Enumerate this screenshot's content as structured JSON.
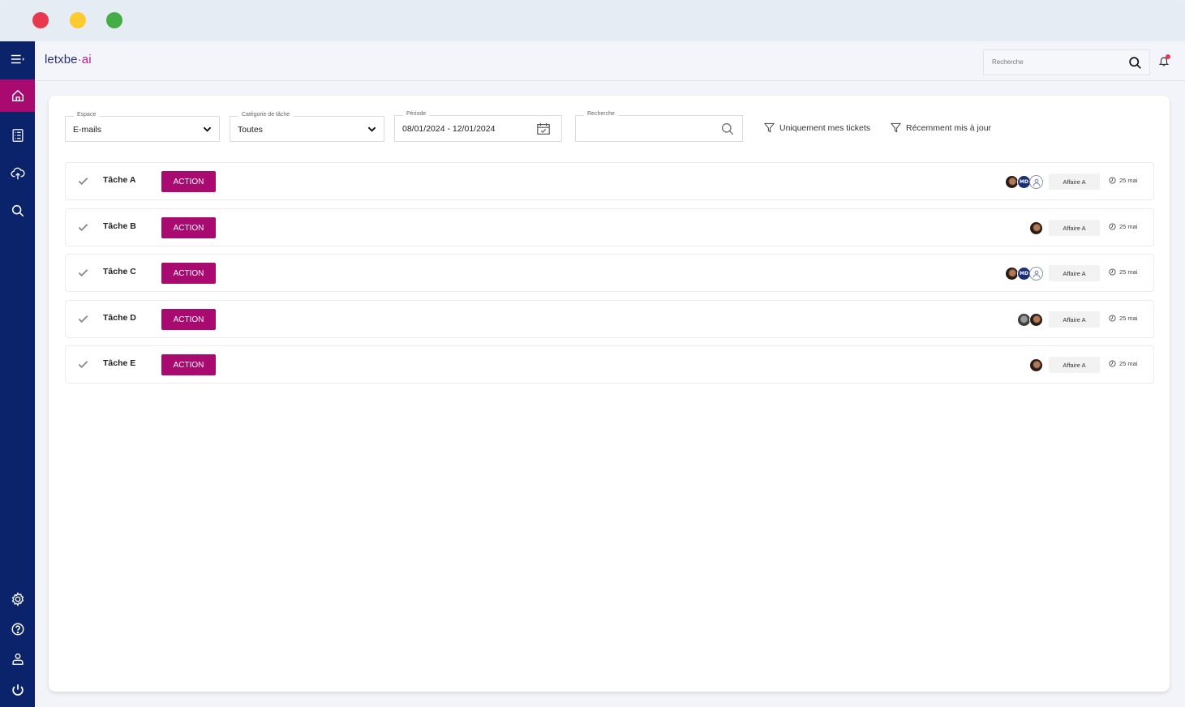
{
  "window": {
    "controls": [
      "close",
      "minimize",
      "maximize"
    ]
  },
  "brand": {
    "logo_main": "letxbe",
    "logo_dot": "·",
    "logo_suffix": "ai"
  },
  "colors": {
    "sidebar": "#0b236b",
    "accent": "#a80a6f",
    "logo": "#2a2e78",
    "logo_ai": "#c21a8c",
    "notification": "#e8384f"
  },
  "topbar": {
    "search_placeholder": "Recherche",
    "notification_icon": "bell-icon"
  },
  "sidebar": {
    "top": [
      {
        "name": "menu",
        "icon": "menu-expand-icon"
      },
      {
        "name": "home",
        "icon": "home-icon",
        "active": true
      },
      {
        "name": "tasks",
        "icon": "checklist-icon"
      },
      {
        "name": "upload",
        "icon": "cloud-upload-icon"
      },
      {
        "name": "search",
        "icon": "search-icon"
      }
    ],
    "bottom": [
      {
        "name": "settings",
        "icon": "gear-icon"
      },
      {
        "name": "help",
        "icon": "help-icon"
      },
      {
        "name": "user",
        "icon": "user-icon"
      },
      {
        "name": "logout",
        "icon": "power-icon"
      }
    ]
  },
  "filters": {
    "espace": {
      "label": "Espace",
      "value": "E-mails"
    },
    "categorie": {
      "label": "Catégorie de tâche",
      "value": "Toutes"
    },
    "periode": {
      "label": "Période",
      "value": "08/01/2024 - 12/01/2024"
    },
    "recherche": {
      "label": "Recherche",
      "value": ""
    },
    "mine": "Uniquement mes tickets",
    "recent": "Récemment mis à jour"
  },
  "tasks": [
    {
      "title": "Tâche A",
      "action": "ACTION",
      "assignees": [
        "photo",
        "MD",
        "placeholder"
      ],
      "tag": "Affaire A",
      "date": "25 mai"
    },
    {
      "title": "Tâche B",
      "action": "ACTION",
      "assignees": [
        "photo"
      ],
      "tag": "Affaire A",
      "date": "25 mai"
    },
    {
      "title": "Tâche C",
      "action": "ACTION",
      "assignees": [
        "photo",
        "MD",
        "placeholder"
      ],
      "tag": "Affaire A",
      "date": "25 mai"
    },
    {
      "title": "Tâche D",
      "action": "ACTION",
      "assignees": [
        "photo-gray",
        "photo"
      ],
      "tag": "Affaire A",
      "date": "25 mai"
    },
    {
      "title": "Tâche E",
      "action": "ACTION",
      "assignees": [
        "photo"
      ],
      "tag": "Affaire A",
      "date": "25 mai"
    }
  ]
}
